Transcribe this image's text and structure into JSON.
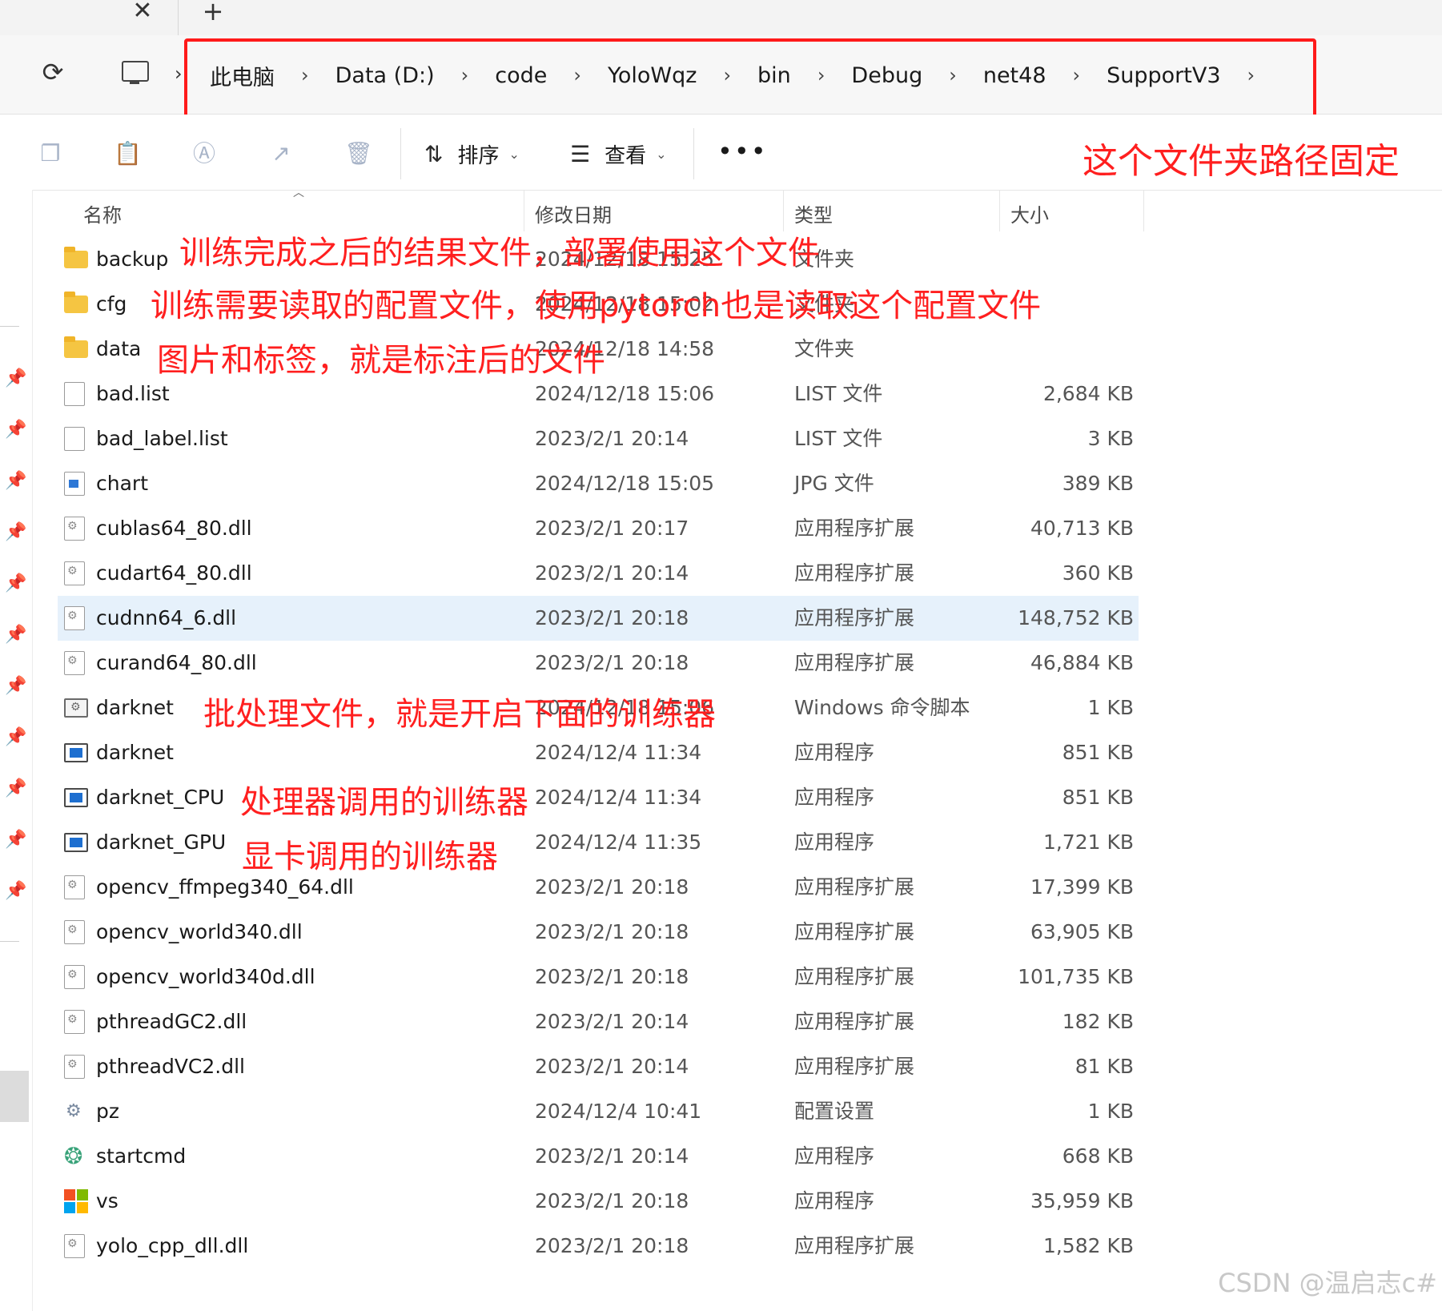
{
  "tabbar": {
    "close_glyph": "✕",
    "add_glyph": "+"
  },
  "address": {
    "crumbs": [
      "此电脑",
      "Data (D:)",
      "code",
      "YoloWqz",
      "bin",
      "Debug",
      "net48",
      "SupportV3"
    ],
    "chevron": "›"
  },
  "toolbar": {
    "sort_label": "排序",
    "view_label": "查看",
    "more_label": "•••"
  },
  "columns": {
    "name": "名称",
    "date": "修改日期",
    "type": "类型",
    "size": "大小"
  },
  "files": [
    {
      "icon": "folder",
      "name": "backup",
      "date": "2024/12/18 15:25",
      "type": "文件夹",
      "size": ""
    },
    {
      "icon": "folder",
      "name": "cfg",
      "date": "2024/12/18 15:02",
      "type": "文件夹",
      "size": ""
    },
    {
      "icon": "folder",
      "name": "data",
      "date": "2024/12/18 14:58",
      "type": "文件夹",
      "size": ""
    },
    {
      "icon": "file",
      "name": "bad.list",
      "date": "2024/12/18 15:06",
      "type": "LIST 文件",
      "size": "2,684 KB"
    },
    {
      "icon": "file",
      "name": "bad_label.list",
      "date": "2023/2/1 20:14",
      "type": "LIST 文件",
      "size": "3 KB"
    },
    {
      "icon": "jpg",
      "name": "chart",
      "date": "2024/12/18 15:05",
      "type": "JPG 文件",
      "size": "389 KB"
    },
    {
      "icon": "dll",
      "name": "cublas64_80.dll",
      "date": "2023/2/1 20:17",
      "type": "应用程序扩展",
      "size": "40,713 KB"
    },
    {
      "icon": "dll",
      "name": "cudart64_80.dll",
      "date": "2023/2/1 20:14",
      "type": "应用程序扩展",
      "size": "360 KB"
    },
    {
      "icon": "dll",
      "name": "cudnn64_6.dll",
      "date": "2023/2/1 20:18",
      "type": "应用程序扩展",
      "size": "148,752 KB",
      "selected": true
    },
    {
      "icon": "dll",
      "name": "curand64_80.dll",
      "date": "2023/2/1 20:18",
      "type": "应用程序扩展",
      "size": "46,884 KB"
    },
    {
      "icon": "bat",
      "name": "darknet",
      "date": "2024/12/18 15:06",
      "type": "Windows 命令脚本",
      "size": "1 KB"
    },
    {
      "icon": "exe",
      "name": "darknet",
      "date": "2024/12/4 11:34",
      "type": "应用程序",
      "size": "851 KB"
    },
    {
      "icon": "exe",
      "name": "darknet_CPU",
      "date": "2024/12/4 11:34",
      "type": "应用程序",
      "size": "851 KB"
    },
    {
      "icon": "exe",
      "name": "darknet_GPU",
      "date": "2024/12/4 11:35",
      "type": "应用程序",
      "size": "1,721 KB"
    },
    {
      "icon": "dll",
      "name": "opencv_ffmpeg340_64.dll",
      "date": "2023/2/1 20:18",
      "type": "应用程序扩展",
      "size": "17,399 KB"
    },
    {
      "icon": "dll",
      "name": "opencv_world340.dll",
      "date": "2023/2/1 20:18",
      "type": "应用程序扩展",
      "size": "63,905 KB"
    },
    {
      "icon": "dll",
      "name": "opencv_world340d.dll",
      "date": "2023/2/1 20:18",
      "type": "应用程序扩展",
      "size": "101,735 KB"
    },
    {
      "icon": "dll",
      "name": "pthreadGC2.dll",
      "date": "2023/2/1 20:14",
      "type": "应用程序扩展",
      "size": "182 KB"
    },
    {
      "icon": "dll",
      "name": "pthreadVC2.dll",
      "date": "2023/2/1 20:14",
      "type": "应用程序扩展",
      "size": "81 KB"
    },
    {
      "icon": "cfgset",
      "name": "pz",
      "date": "2024/12/4 10:41",
      "type": "配置设置",
      "size": "1 KB"
    },
    {
      "icon": "globe",
      "name": "startcmd",
      "date": "2023/2/1 20:14",
      "type": "应用程序",
      "size": "668 KB"
    },
    {
      "icon": "ms",
      "name": "vs",
      "date": "2023/2/1 20:18",
      "type": "应用程序",
      "size": "35,959 KB"
    },
    {
      "icon": "dll",
      "name": "yolo_cpp_dll.dll",
      "date": "2023/2/1 20:18",
      "type": "应用程序扩展",
      "size": "1,582 KB"
    }
  ],
  "annotations": {
    "path_fixed": "这个文件夹路径固定",
    "backup": "训练完成之后的结果文件，部署使用这个文件",
    "cfg": "训练需要读取的配置文件，使用pytorch也是读取这个配置文件",
    "data": "图片和标签，就是标注后的文件",
    "batch": "批处理文件，就是开启下面的训练器",
    "cpu": "处理器调用的训练器",
    "gpu": "显卡调用的训练器"
  },
  "watermark": "CSDN @温启志c#",
  "colors": {
    "annotation": "#ff1f1f",
    "selected_row": "#e6f1fb",
    "accent": "#1e6fd0"
  }
}
